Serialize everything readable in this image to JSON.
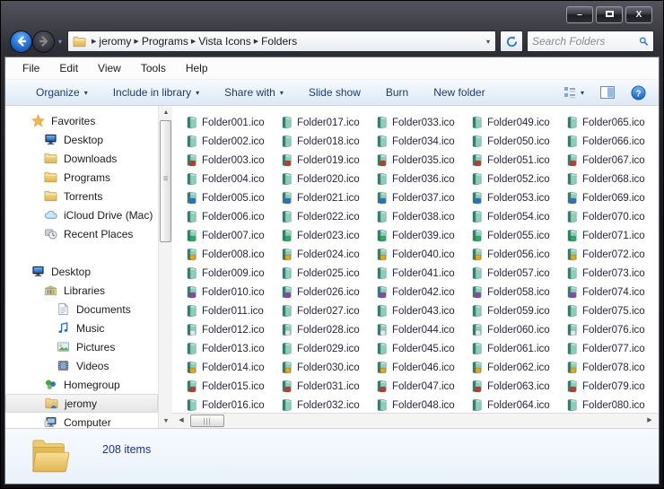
{
  "window": {
    "controls": {
      "minimize": "minimize",
      "maximize": "maximize",
      "close": "close"
    }
  },
  "address_bar": {
    "breadcrumb": [
      "jeromy",
      "Programs",
      "Vista Icons",
      "Folders"
    ],
    "search_placeholder": "Search Folders"
  },
  "menu": [
    "File",
    "Edit",
    "View",
    "Tools",
    "Help"
  ],
  "toolbar": {
    "left": [
      {
        "label": "Organize",
        "dropdown": true
      },
      {
        "label": "Include in library",
        "dropdown": true
      },
      {
        "label": "Share with",
        "dropdown": true
      },
      {
        "label": "Slide show",
        "dropdown": false
      },
      {
        "label": "Burn",
        "dropdown": false
      },
      {
        "label": "New folder",
        "dropdown": false
      }
    ]
  },
  "sidebar": {
    "sections": [
      {
        "label": "Favorites",
        "icon": "star-icon",
        "items": [
          {
            "label": "Desktop",
            "icon": "desktop-icon",
            "level": 1
          },
          {
            "label": "Downloads",
            "icon": "folder-icon",
            "level": 1
          },
          {
            "label": "Programs",
            "icon": "folder-icon",
            "level": 1
          },
          {
            "label": "Torrents",
            "icon": "folder-icon",
            "level": 1
          },
          {
            "label": "iCloud Drive (Mac)",
            "icon": "cloud-icon",
            "level": 1
          },
          {
            "label": "Recent Places",
            "icon": "recent-icon",
            "level": 1
          }
        ]
      },
      {
        "label": "Desktop",
        "icon": "desktop-icon",
        "items": [
          {
            "label": "Libraries",
            "icon": "libraries-icon",
            "level": 1
          },
          {
            "label": "Documents",
            "icon": "document-icon",
            "level": 2
          },
          {
            "label": "Music",
            "icon": "music-icon",
            "level": 2
          },
          {
            "label": "Pictures",
            "icon": "pictures-icon",
            "level": 2
          },
          {
            "label": "Videos",
            "icon": "videos-icon",
            "level": 2
          },
          {
            "label": "Homegroup",
            "icon": "homegroup-icon",
            "level": 1
          },
          {
            "label": "jeromy",
            "icon": "user-folder-icon",
            "level": 1,
            "selected": true
          },
          {
            "label": "Computer",
            "icon": "computer-icon",
            "level": 1
          }
        ]
      }
    ]
  },
  "files": {
    "columns": 5,
    "rows": 16,
    "icon": "vista-folder-icon",
    "items": [
      "Folder001.ico",
      "Folder002.ico",
      "Folder003.ico",
      "Folder004.ico",
      "Folder005.ico",
      "Folder006.ico",
      "Folder007.ico",
      "Folder008.ico",
      "Folder009.ico",
      "Folder010.ico",
      "Folder011.ico",
      "Folder012.ico",
      "Folder013.ico",
      "Folder014.ico",
      "Folder015.ico",
      "Folder016.ico",
      "Folder017.ico",
      "Folder018.ico",
      "Folder019.ico",
      "Folder020.ico",
      "Folder021.ico",
      "Folder022.ico",
      "Folder023.ico",
      "Folder024.ico",
      "Folder025.ico",
      "Folder026.ico",
      "Folder027.ico",
      "Folder028.ico",
      "Folder029.ico",
      "Folder030.ico",
      "Folder031.ico",
      "Folder032.ico",
      "Folder033.ico",
      "Folder034.ico",
      "Folder035.ico",
      "Folder036.ico",
      "Folder037.ico",
      "Folder038.ico",
      "Folder039.ico",
      "Folder040.ico",
      "Folder041.ico",
      "Folder042.ico",
      "Folder043.ico",
      "Folder044.ico",
      "Folder045.ico",
      "Folder046.ico",
      "Folder047.ico",
      "Folder048.ico",
      "Folder049.ico",
      "Folder050.ico",
      "Folder051.ico",
      "Folder052.ico",
      "Folder053.ico",
      "Folder054.ico",
      "Folder055.ico",
      "Folder056.ico",
      "Folder057.ico",
      "Folder058.ico",
      "Folder059.ico",
      "Folder060.ico",
      "Folder061.ico",
      "Folder062.ico",
      "Folder063.ico",
      "Folder064.ico",
      "Folder065.ico",
      "Folder066.ico",
      "Folder067.ico",
      "Folder068.ico",
      "Folder069.ico",
      "Folder070.ico",
      "Folder071.ico",
      "Folder072.ico",
      "Folder073.ico",
      "Folder074.ico",
      "Folder075.ico",
      "Folder076.ico",
      "Folder077.ico",
      "Folder078.ico",
      "Folder079.ico",
      "Folder080.ico"
    ]
  },
  "status_bar": {
    "text": "208 items"
  },
  "colors": {
    "accent_blue": "#2b7cd6",
    "toolbar_text": "#1f3a6e",
    "status_text": "#1e3287",
    "folder_gold": "#e9c162",
    "folder_teal": "#8fcdb8"
  }
}
